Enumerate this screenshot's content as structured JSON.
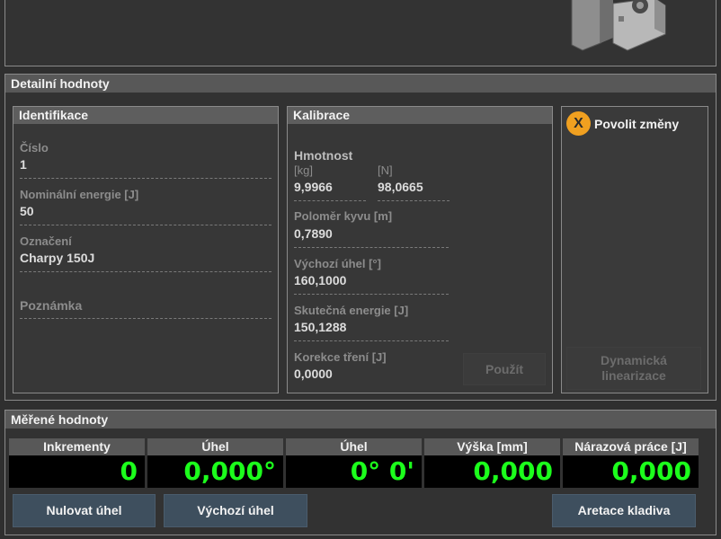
{
  "detail": {
    "title": "Detailní hodnoty",
    "identification": {
      "title": "Identifikace",
      "number_label": "Číslo",
      "number_value": "1",
      "nominal_energy_label": "Nominální energie [J]",
      "nominal_energy_value": "50",
      "designation_label": "Označení",
      "designation_value": "Charpy 150J",
      "note_label": "Poznámka"
    },
    "calibration": {
      "title": "Kalibrace",
      "mass_label": "Hmotnost",
      "mass_kg_unit": "[kg]",
      "mass_kg_value": "9,9966",
      "mass_n_unit": "[N]",
      "mass_n_value": "98,0665",
      "radius_label": "Poloměr kyvu [m]",
      "radius_value": "0,7890",
      "start_angle_label": "Výchozí úhel [°]",
      "start_angle_value": "160,1000",
      "real_energy_label": "Skutečná energie [J]",
      "real_energy_value": "150,1288",
      "friction_label": "Korekce tření [J]",
      "friction_value": "0,0000",
      "apply_label": "Použít"
    },
    "allow_changes": {
      "icon_letter": "X",
      "label": "Povolit změny",
      "dynamic_line1": "Dynamická",
      "dynamic_line2": "linearizace"
    }
  },
  "measured": {
    "title": "Měřené hodnoty",
    "columns": [
      {
        "header": "Inkrementy",
        "value": "0"
      },
      {
        "header": "Úhel",
        "value": "0,000°"
      },
      {
        "header": "Úhel",
        "value": "0° 0'"
      },
      {
        "header": "Výška [mm]",
        "value": "0,000"
      },
      {
        "header": "Nárazová práce [J]",
        "value": "0,000"
      }
    ],
    "buttons": {
      "reset_angle": "Nulovat úhel",
      "start_angle": "Výchozí úhel",
      "hammer_lock": "Aretace kladiva"
    }
  },
  "colors": {
    "accent_orange": "#f0a020",
    "digit_green": "#1cff1c",
    "button_blue": "#3e4f5e"
  }
}
